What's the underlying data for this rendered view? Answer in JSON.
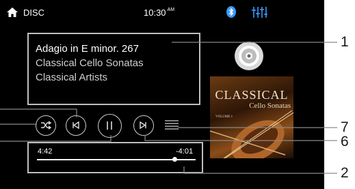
{
  "status_bar": {
    "source": "DISC",
    "time": "10:30",
    "ampm": "AM",
    "icons": [
      "home-icon",
      "bluetooth-icon",
      "equalizer-icon"
    ],
    "accent_color": "#3a9bff"
  },
  "now_playing": {
    "title": "Adagio in E minor. 267",
    "album": "Classical Cello Sonatas",
    "artist": "Classical Artists"
  },
  "album_art": {
    "title": "CLASSICAL",
    "subtitle": "Cello Sonatas",
    "volume": "VOLUME 1"
  },
  "controls": [
    "shuffle-button",
    "previous-track-button",
    "play-pause-button",
    "next-track-button",
    "track-list-button"
  ],
  "progress": {
    "elapsed": "4:42",
    "remaining": "-4:01",
    "fraction": 0.87
  },
  "callouts": [
    "1",
    "7",
    "6",
    "2"
  ]
}
